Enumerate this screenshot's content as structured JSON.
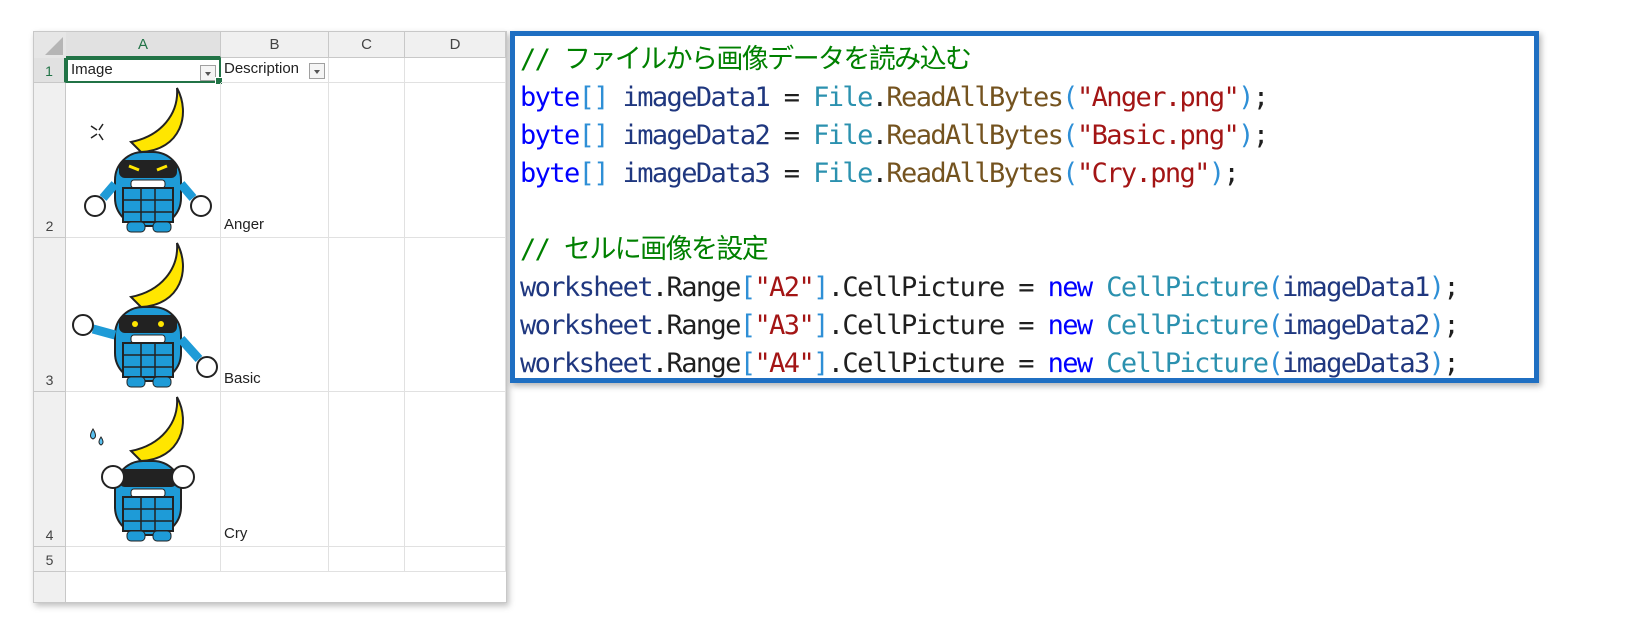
{
  "spreadsheet": {
    "columns": [
      "A",
      "B",
      "C",
      "D"
    ],
    "rows": [
      "1",
      "2",
      "3",
      "4",
      "5"
    ],
    "header_cells": [
      "Image",
      "Description"
    ],
    "descriptions": [
      "Anger",
      "Basic",
      "Cry"
    ],
    "active_cell": "A1",
    "colors": {
      "selection": "#217346",
      "mascot_blue": "#1e9bd7",
      "helmet_yellow": "#ffe600"
    }
  },
  "code": {
    "comment1": "// ファイルから画像データを読み込む",
    "comment2": "// セルに画像を設定",
    "read_lines": [
      {
        "type": "byte",
        "brackets": "[]",
        "var": "imageData1",
        "eq": " = ",
        "cls": "File",
        "dot": ".",
        "method": "ReadAllBytes",
        "open": "(",
        "str": "\"Anger.png\"",
        "close": ")",
        "end": ";"
      },
      {
        "type": "byte",
        "brackets": "[]",
        "var": "imageData2",
        "eq": " = ",
        "cls": "File",
        "dot": ".",
        "method": "ReadAllBytes",
        "open": "(",
        "str": "\"Basic.png\"",
        "close": ")",
        "end": ";"
      },
      {
        "type": "byte",
        "brackets": "[]",
        "var": "imageData3",
        "eq": " = ",
        "cls": "File",
        "dot": ".",
        "method": "ReadAllBytes",
        "open": "(",
        "str": "\"Cry.png\"",
        "close": ")",
        "end": ";"
      }
    ],
    "set_lines": [
      {
        "obj": "worksheet",
        "range": ".Range",
        "lb": "[",
        "str": "\"A2\"",
        "rb": "]",
        "prop": ".CellPicture = ",
        "kw": "new",
        "cls": " CellPicture",
        "open": "(",
        "arg": "imageData1",
        "close": ")",
        "end": ";"
      },
      {
        "obj": "worksheet",
        "range": ".Range",
        "lb": "[",
        "str": "\"A3\"",
        "rb": "]",
        "prop": ".CellPicture = ",
        "kw": "new",
        "cls": " CellPicture",
        "open": "(",
        "arg": "imageData2",
        "close": ")",
        "end": ";"
      },
      {
        "obj": "worksheet",
        "range": ".Range",
        "lb": "[",
        "str": "\"A4\"",
        "rb": "]",
        "prop": ".CellPicture = ",
        "kw": "new",
        "cls": " CellPicture",
        "open": "(",
        "arg": "imageData3",
        "close": ")",
        "end": ";"
      }
    ],
    "colors": {
      "border": "#1f6fc2",
      "comment": "#008000",
      "keyword": "#0000ff",
      "type": "#2b91af",
      "method": "#74531f",
      "string": "#a31515"
    }
  }
}
